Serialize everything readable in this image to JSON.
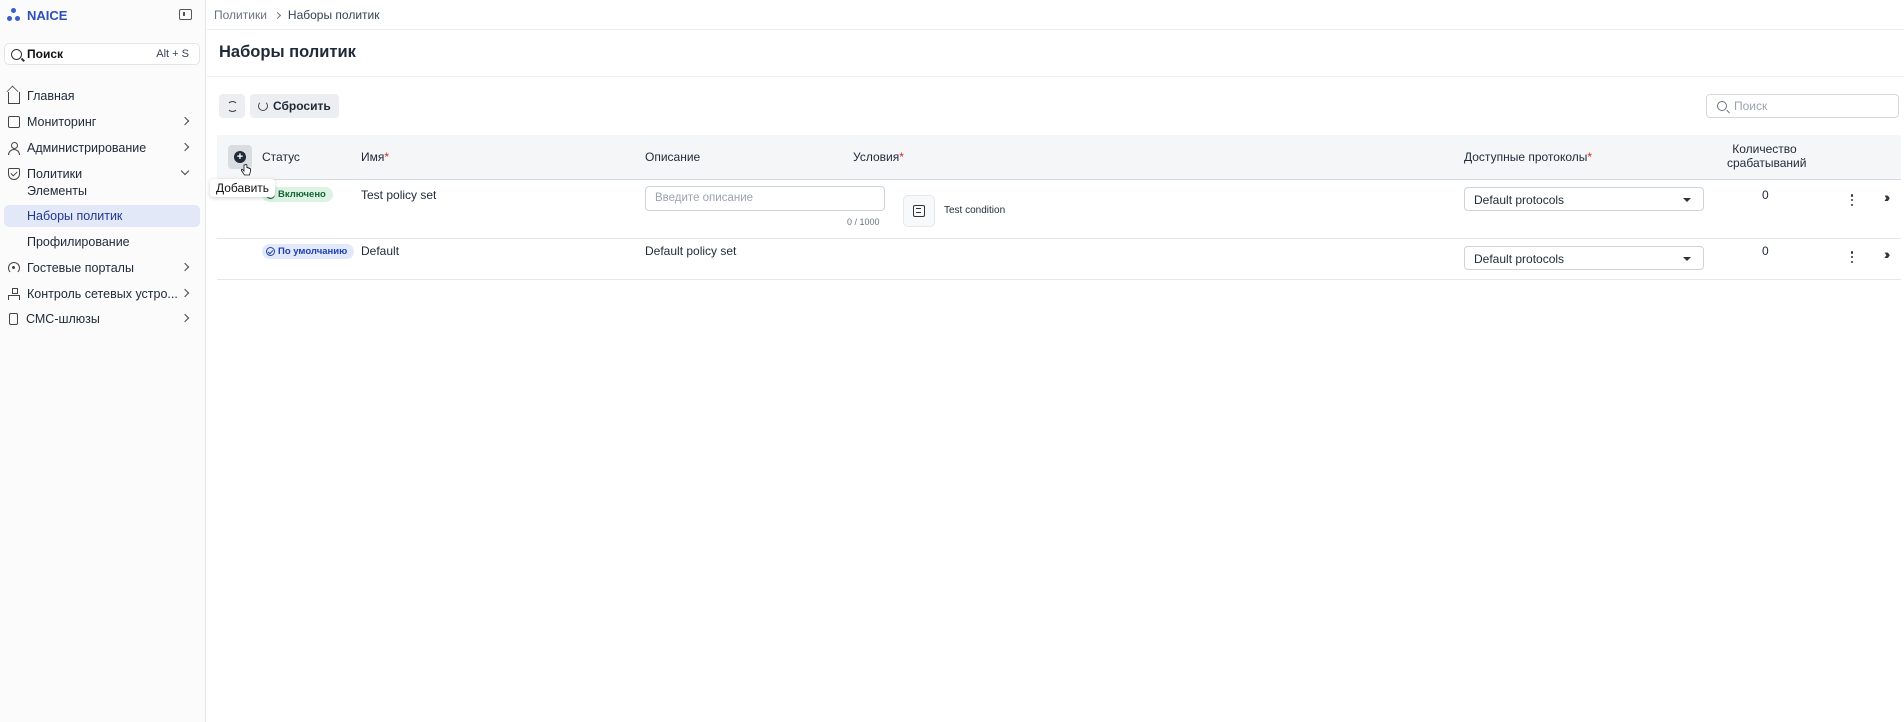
{
  "app": {
    "name": "NAICE"
  },
  "search": {
    "label": "Поиск",
    "shortcut": "Alt + S"
  },
  "sidebar": {
    "items": [
      {
        "label": "Главная"
      },
      {
        "label": "Мониторинг"
      },
      {
        "label": "Администрирование"
      },
      {
        "label": "Политики"
      },
      {
        "label": "Элементы"
      },
      {
        "label": "Наборы политик"
      },
      {
        "label": "Профилирование"
      },
      {
        "label": "Гостевые порталы"
      },
      {
        "label": "Контроль сетевых устро..."
      },
      {
        "label": "СМС-шлюзы"
      }
    ]
  },
  "breadcrumb": {
    "parent": "Политики",
    "current": "Наборы политик"
  },
  "page": {
    "title": "Наборы политик"
  },
  "toolbar": {
    "reset_label": "Сбросить",
    "search_placeholder": "Поиск"
  },
  "table": {
    "headers": {
      "status": "Статус",
      "name": "Имя",
      "description": "Описание",
      "conditions": "Условия",
      "protocols": "Доступные протоколы",
      "count_line1": "Количество",
      "count_line2": "срабатываний",
      "required": "*"
    },
    "add_tooltip": "Добавить",
    "rows": [
      {
        "status": "Включено",
        "name": "Test policy set",
        "description_placeholder": "Введите описание",
        "description_counter": "0 / 1000",
        "condition": "Test condition",
        "protocol": "Default protocols",
        "count": "0"
      },
      {
        "status": "По умолчанию",
        "name": "Default",
        "description": "Default policy set",
        "protocol": "Default protocols",
        "count": "0"
      }
    ]
  },
  "colors": {
    "accent": "#2d4fb8",
    "active_bg": "#e3e8f8",
    "enabled_badge": "#dcf3e4",
    "default_badge": "#e2e9fb",
    "required": "#dc2626"
  }
}
